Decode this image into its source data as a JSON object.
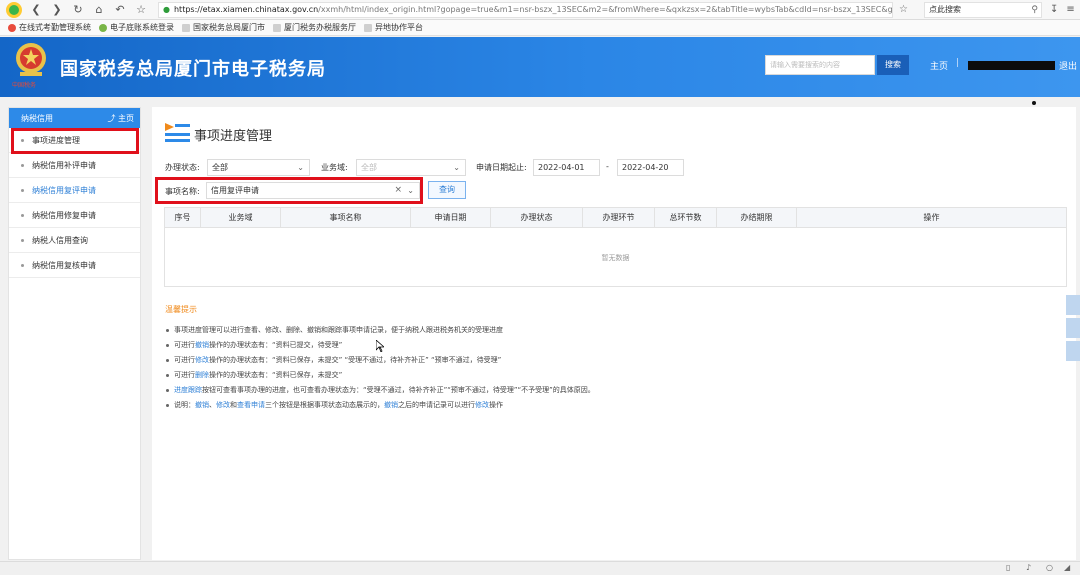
{
  "browser": {
    "url_host": "https://etax.xiamen.chinatax.gov.cn",
    "url_path": "/xxmh/html/index_origin.html?gopage=true&m1=nsr-bszx_13SEC&m2=&fromWhere=&qxkzsx=2&tabTitle=wybsTab&cdId=nsr-bszx_13SEC&gnDm=nsr-",
    "search_text": "点此搜索",
    "bookmarks": [
      "在线式考勤管理系统",
      "电子底账系统登录",
      "国家税务总局厦门市",
      "厦门税务办税服务厅",
      "异地协作平台"
    ]
  },
  "header": {
    "title": "国家税务总局厦门市电子税务局",
    "emblem_caption": "中国税务",
    "search_placeholder": "请输入需要搜索的内容",
    "search_button": "搜索",
    "home": "主页",
    "separator": "|",
    "logout": "退出"
  },
  "sidebar": {
    "title": "纳税信用",
    "home": "主页",
    "items": [
      {
        "label": "事项进度管理"
      },
      {
        "label": "纳税信用补评申请"
      },
      {
        "label": "纳税信用复评申请"
      },
      {
        "label": "纳税信用修复申请"
      },
      {
        "label": "纳税人信用查询"
      },
      {
        "label": "纳税信用复核申请"
      }
    ]
  },
  "main": {
    "title": "事项进度管理",
    "filters": {
      "status_label": "办理状态:",
      "status_value": "全部",
      "domain_label": "业务域:",
      "domain_value": "全部",
      "date_label": "申请日期起止:",
      "date_from": "2022-04-01",
      "date_sep": "-",
      "date_to": "2022-04-20",
      "item_label": "事项名称:",
      "item_value": "信用复评申请",
      "query_button": "查询"
    },
    "table": {
      "columns": [
        "序号",
        "业务域",
        "事项名称",
        "申请日期",
        "办理状态",
        "办理环节",
        "总环节数",
        "办结期限",
        "操作"
      ],
      "empty_text": "暂无数据"
    },
    "tips": {
      "title": "温馨提示",
      "lines": [
        {
          "parts": [
            "事项进度管理可以进行查看、修改、删除、撤销和跟踪事项申请记录，便于纳税人跟进税务机关的受理进度"
          ]
        },
        {
          "pre": "可进行",
          "link": "撤销",
          "post": "操作的办理状态有：“资料已提交，待受理”"
        },
        {
          "pre": "可进行",
          "link": "修改",
          "post": "操作的办理状态有：“资料已保存，未提交” “受理不通过，待补齐补正” “预审不通过，待受理”"
        },
        {
          "pre": "可进行",
          "link": "删除",
          "post": "操作的办理状态有：“资料已保存，未提交”"
        },
        {
          "pre": "",
          "link": "进度跟踪",
          "post": "按钮可查看事项办理的进度，也可查看办理状态为：“受理不通过，待补齐补正”“预审不通过，待受理”“不予受理”的具体原因。"
        }
      ],
      "last": {
        "a": "说明：",
        "l1": "撤销",
        "s1": "、",
        "l2": "修改",
        "s2": "和",
        "l3": "查看申请",
        "b": "三个按钮是根据事项状态动态展示的，",
        "l4": "撤销",
        "c": "之后的申请记录可以进行",
        "l5": "修改",
        "d": "操作"
      }
    }
  }
}
